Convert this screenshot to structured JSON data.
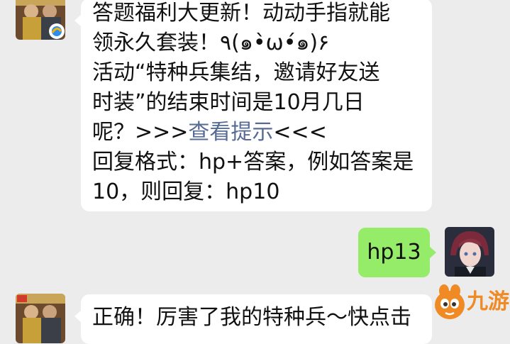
{
  "messages": [
    {
      "sender": "official-account",
      "lines": [
        "答题福利大更新！动动手指就能",
        "领永久套装！٩(๑•̀ω•́๑)۶",
        "活动“特种兵集结，邀请好友送",
        "时装”的结束时间是10月几日"
      ],
      "line5_prefix": "呢？>>>",
      "line5_link": "查看提示",
      "line5_suffix": "<<<",
      "lines_after": [
        "回复格式：hp+答案，例如答案是",
        "10，则回复：hp10"
      ]
    },
    {
      "sender": "user",
      "text": "hp13"
    },
    {
      "sender": "official-account",
      "text": "正确！厉害了我的特种兵～快点击"
    }
  ],
  "watermark": {
    "text": "九游"
  },
  "colors": {
    "chat_background": "#ececec",
    "incoming_bubble": "#ffffff",
    "outgoing_bubble": "#95ec69",
    "link": "#576b95",
    "watermark_orange": "#f08a24"
  }
}
